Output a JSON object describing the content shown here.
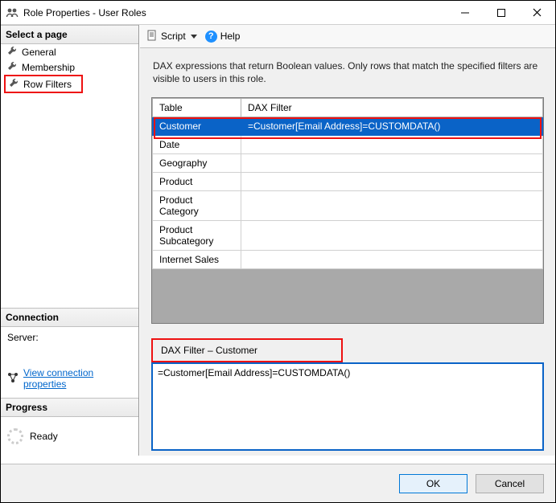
{
  "window": {
    "title": "Role Properties - User Roles"
  },
  "sidebar": {
    "select_page": "Select a page",
    "items": [
      {
        "label": "General"
      },
      {
        "label": "Membership"
      },
      {
        "label": "Row Filters"
      }
    ],
    "connection_head": "Connection",
    "server_label": "Server:",
    "conn_link": "View connection properties",
    "progress_head": "Progress",
    "progress_status": "Ready"
  },
  "toolbar": {
    "script": "Script",
    "help": "Help"
  },
  "content": {
    "description": "DAX expressions that return Boolean values. Only rows that match the specified filters are visible to users in this role.",
    "col_table": "Table",
    "col_filter": "DAX Filter",
    "rows": [
      {
        "table": "Customer",
        "filter": "=Customer[Email Address]=CUSTOMDATA()"
      },
      {
        "table": "Date",
        "filter": ""
      },
      {
        "table": "Geography",
        "filter": ""
      },
      {
        "table": "Product",
        "filter": ""
      },
      {
        "table": "Product Category",
        "filter": ""
      },
      {
        "table": "Product Subcategory",
        "filter": ""
      },
      {
        "table": "Internet Sales",
        "filter": ""
      }
    ],
    "filter_label": "DAX Filter – Customer",
    "filter_expr": "=Customer[Email Address]=CUSTOMDATA()"
  },
  "footer": {
    "ok": "OK",
    "cancel": "Cancel"
  }
}
